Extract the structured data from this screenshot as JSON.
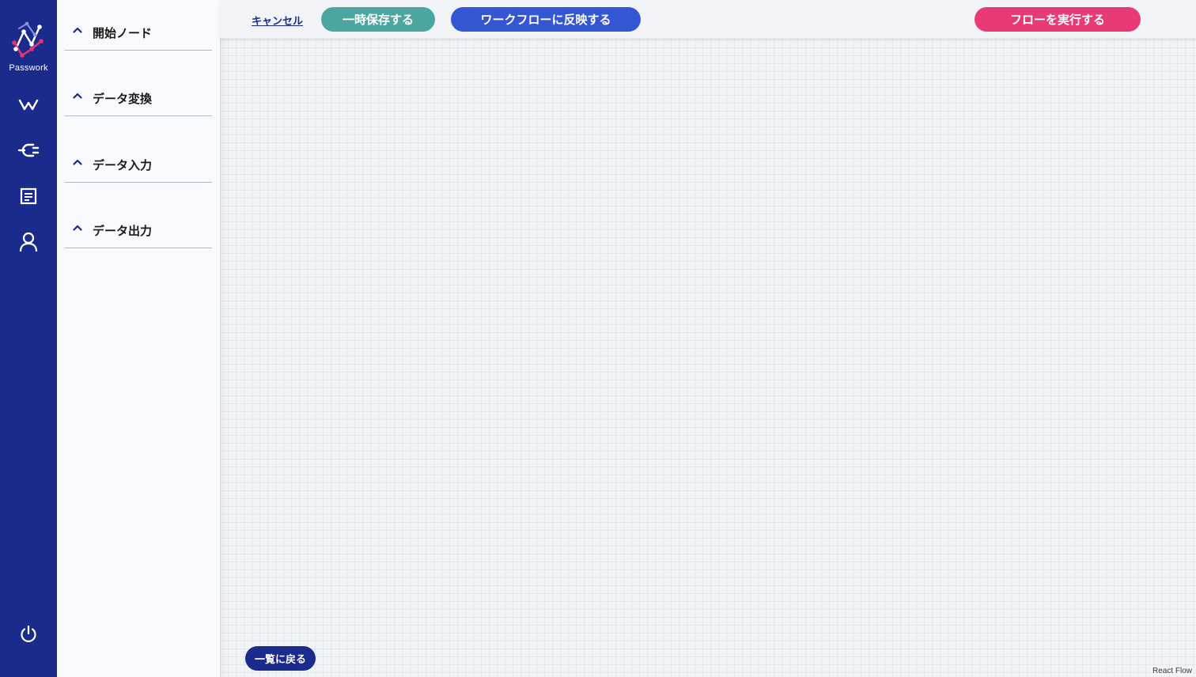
{
  "app": {
    "logo_text": "Passwork"
  },
  "nav": {
    "items": [
      {
        "icon": "workflow-icon"
      },
      {
        "icon": "plug-icon"
      },
      {
        "icon": "document-icon"
      },
      {
        "icon": "user-icon"
      }
    ],
    "power_icon": "power-icon"
  },
  "palette": {
    "sections": [
      {
        "label": "開始ノード",
        "expanded": false
      },
      {
        "label": "データ変換",
        "expanded": false
      },
      {
        "label": "データ入力",
        "expanded": false
      },
      {
        "label": "データ出力",
        "expanded": false
      }
    ]
  },
  "toolbar": {
    "cancel_label": "キャンセル",
    "save_draft_label": "一時保存する",
    "apply_workflow_label": "ワークフローに反映する",
    "run_flow_label": "フローを実行する"
  },
  "canvas": {
    "back_to_list_label": "一覧に戻る",
    "attribution": "React Flow"
  },
  "colors": {
    "nav_bg": "#1b2b8c",
    "save_button": "#4ca59e",
    "apply_button": "#3556d2",
    "run_button": "#e83a75",
    "logo_accent": "#e8336f"
  }
}
